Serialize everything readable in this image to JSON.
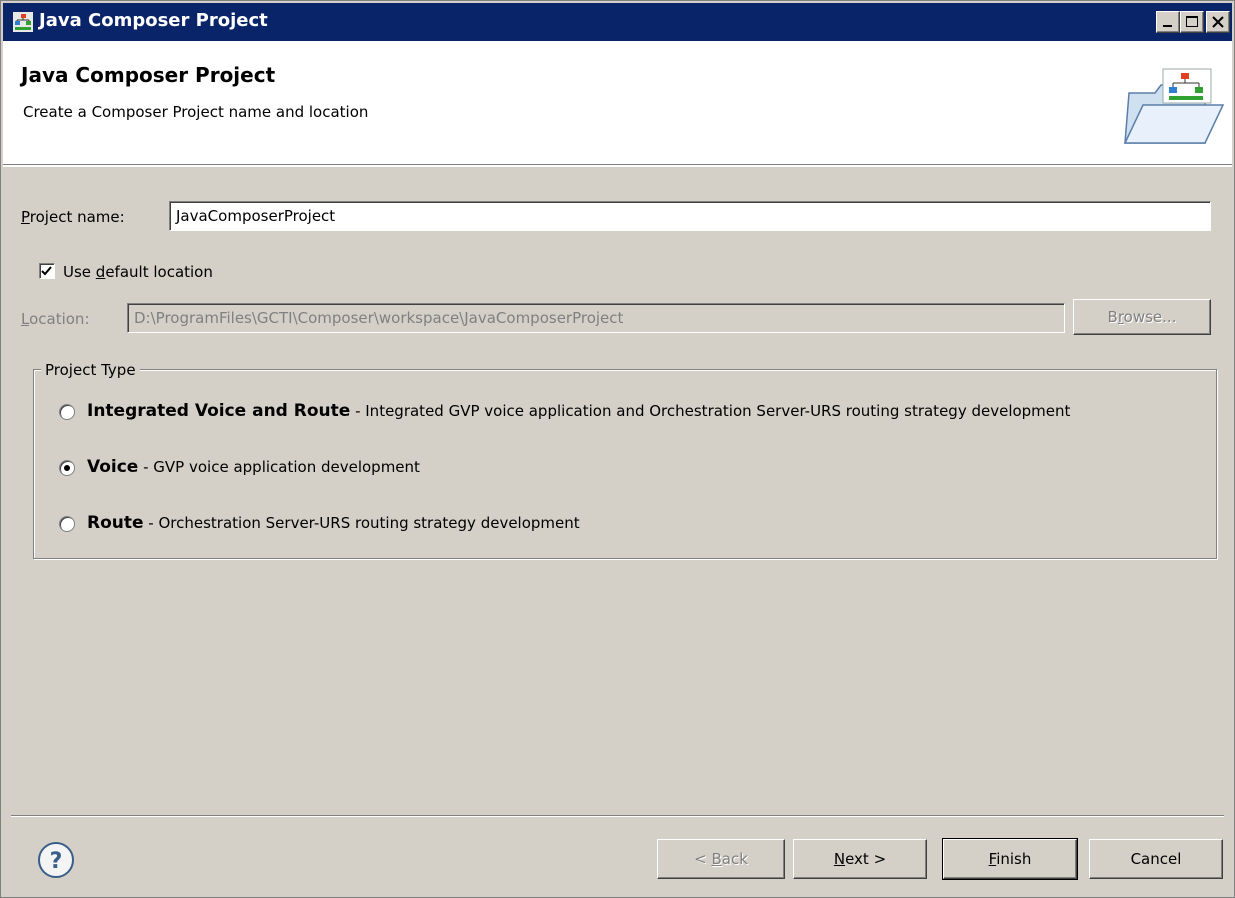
{
  "window": {
    "title": "Java Composer Project",
    "icon": "wizard-app-icon",
    "controls": [
      "minimize-icon",
      "maximize-icon",
      "close-icon"
    ]
  },
  "banner": {
    "title": "Java Composer Project",
    "description": "Create a Composer Project name and location",
    "icon": "folder-icon"
  },
  "form": {
    "project_name_label_mn": "P",
    "project_name_label_rest": "roject name:",
    "project_name_value": "JavaComposerProject",
    "use_default_checked": true,
    "use_default_label_pre": "Use ",
    "use_default_label_mn": "d",
    "use_default_label_rest": "efault location",
    "location_label_mn": "L",
    "location_label_rest": "ocation:",
    "location_value": "D:\\ProgramFiles\\GCTI\\Composer\\workspace\\JavaComposerProject",
    "browse_pre": "B",
    "browse_mn": "r",
    "browse_rest": "owse..."
  },
  "project_type": {
    "legend": "Project Type",
    "selected": "voice",
    "options": [
      {
        "id": "integrated",
        "name": "Integrated Voice and Route",
        "description": " - Integrated GVP voice application and Orchestration Server-URS routing strategy development"
      },
      {
        "id": "voice",
        "name": "Voice",
        "description": " - GVP voice application development"
      },
      {
        "id": "route",
        "name": "Route",
        "description": " - Orchestration Server-URS routing strategy development"
      }
    ]
  },
  "footer": {
    "help_icon": "help-icon",
    "back_pre": "< ",
    "back_mn": "B",
    "back_rest": "ack",
    "next_mn": "N",
    "next_rest": "ext >",
    "finish_mn": "F",
    "finish_rest": "inish",
    "cancel": "Cancel"
  },
  "colors": {
    "titlebar": "#0a246a",
    "dialog_bg": "#d4d0c8",
    "banner_bg": "#ffffff"
  }
}
